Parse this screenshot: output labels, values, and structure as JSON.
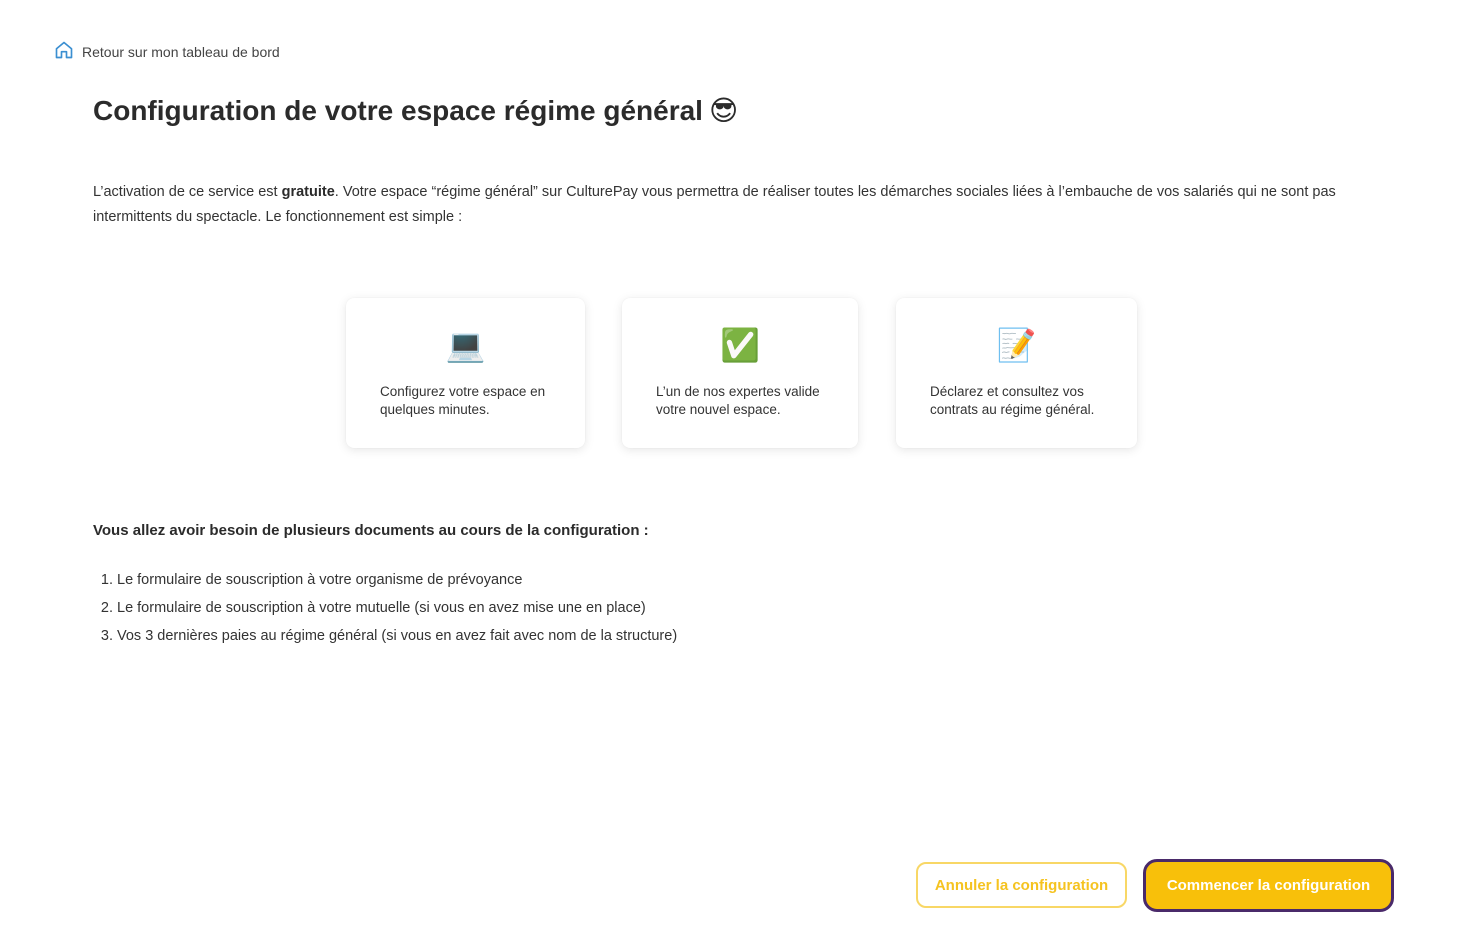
{
  "back_link": {
    "label": "Retour sur mon tableau de bord",
    "icon": "home-icon"
  },
  "title": {
    "text": "Configuration de votre espace régime général",
    "emoji": "😎"
  },
  "intro": {
    "part1": "L’activation de ce service est ",
    "bold": "gratuite",
    "part2": ". Votre espace “régime général” sur CulturePay vous permettra de réaliser toutes les démarches sociales liées à l’embauche de vos salariés qui ne sont pas intermittents du spectacle. Le fonctionnement est simple :"
  },
  "steps": [
    {
      "icon": "💻",
      "text": "Configurez votre espace en quelques minutes."
    },
    {
      "icon": "✅",
      "text": "L’un de nos expertes valide votre nouvel espace."
    },
    {
      "icon": "📝",
      "text": "Déclarez et consultez vos contrats au régime général."
    }
  ],
  "documents": {
    "heading": "Vous allez avoir besoin de plusieurs documents au cours de la configuration :",
    "items": [
      "Le formulaire de souscription à votre organisme de prévoyance",
      "Le formulaire de souscription à votre mutuelle (si vous en avez mise une en place)",
      "Vos 3 dernières paies au régime général (si vous en avez fait avec nom de la structure)"
    ]
  },
  "buttons": {
    "cancel": "Annuler la configuration",
    "start": "Commencer la configuration"
  },
  "colors": {
    "accent": "#f8c00a",
    "focus_border": "#4a2a6a",
    "link_icon": "#3b8fd1"
  }
}
